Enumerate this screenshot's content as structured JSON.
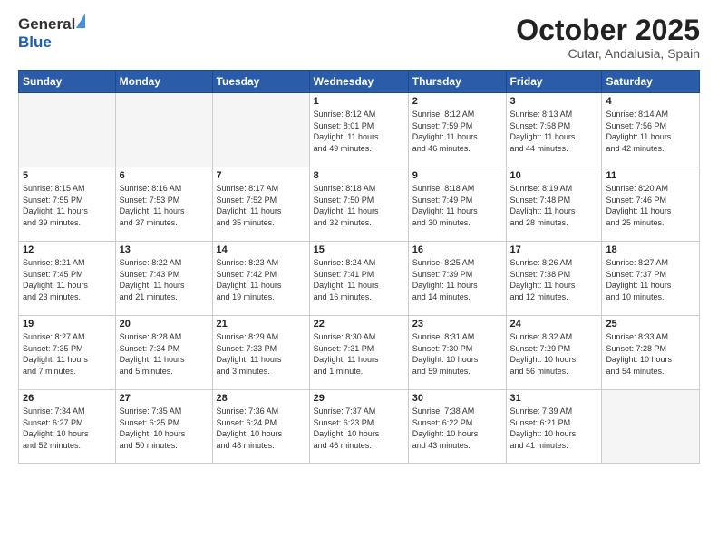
{
  "header": {
    "logo_general": "General",
    "logo_blue": "Blue",
    "title": "October 2025",
    "subtitle": "Cutar, Andalusia, Spain"
  },
  "days_of_week": [
    "Sunday",
    "Monday",
    "Tuesday",
    "Wednesday",
    "Thursday",
    "Friday",
    "Saturday"
  ],
  "weeks": [
    [
      {
        "day": "",
        "info": ""
      },
      {
        "day": "",
        "info": ""
      },
      {
        "day": "",
        "info": ""
      },
      {
        "day": "1",
        "info": "Sunrise: 8:12 AM\nSunset: 8:01 PM\nDaylight: 11 hours\nand 49 minutes."
      },
      {
        "day": "2",
        "info": "Sunrise: 8:12 AM\nSunset: 7:59 PM\nDaylight: 11 hours\nand 46 minutes."
      },
      {
        "day": "3",
        "info": "Sunrise: 8:13 AM\nSunset: 7:58 PM\nDaylight: 11 hours\nand 44 minutes."
      },
      {
        "day": "4",
        "info": "Sunrise: 8:14 AM\nSunset: 7:56 PM\nDaylight: 11 hours\nand 42 minutes."
      }
    ],
    [
      {
        "day": "5",
        "info": "Sunrise: 8:15 AM\nSunset: 7:55 PM\nDaylight: 11 hours\nand 39 minutes."
      },
      {
        "day": "6",
        "info": "Sunrise: 8:16 AM\nSunset: 7:53 PM\nDaylight: 11 hours\nand 37 minutes."
      },
      {
        "day": "7",
        "info": "Sunrise: 8:17 AM\nSunset: 7:52 PM\nDaylight: 11 hours\nand 35 minutes."
      },
      {
        "day": "8",
        "info": "Sunrise: 8:18 AM\nSunset: 7:50 PM\nDaylight: 11 hours\nand 32 minutes."
      },
      {
        "day": "9",
        "info": "Sunrise: 8:18 AM\nSunset: 7:49 PM\nDaylight: 11 hours\nand 30 minutes."
      },
      {
        "day": "10",
        "info": "Sunrise: 8:19 AM\nSunset: 7:48 PM\nDaylight: 11 hours\nand 28 minutes."
      },
      {
        "day": "11",
        "info": "Sunrise: 8:20 AM\nSunset: 7:46 PM\nDaylight: 11 hours\nand 25 minutes."
      }
    ],
    [
      {
        "day": "12",
        "info": "Sunrise: 8:21 AM\nSunset: 7:45 PM\nDaylight: 11 hours\nand 23 minutes."
      },
      {
        "day": "13",
        "info": "Sunrise: 8:22 AM\nSunset: 7:43 PM\nDaylight: 11 hours\nand 21 minutes."
      },
      {
        "day": "14",
        "info": "Sunrise: 8:23 AM\nSunset: 7:42 PM\nDaylight: 11 hours\nand 19 minutes."
      },
      {
        "day": "15",
        "info": "Sunrise: 8:24 AM\nSunset: 7:41 PM\nDaylight: 11 hours\nand 16 minutes."
      },
      {
        "day": "16",
        "info": "Sunrise: 8:25 AM\nSunset: 7:39 PM\nDaylight: 11 hours\nand 14 minutes."
      },
      {
        "day": "17",
        "info": "Sunrise: 8:26 AM\nSunset: 7:38 PM\nDaylight: 11 hours\nand 12 minutes."
      },
      {
        "day": "18",
        "info": "Sunrise: 8:27 AM\nSunset: 7:37 PM\nDaylight: 11 hours\nand 10 minutes."
      }
    ],
    [
      {
        "day": "19",
        "info": "Sunrise: 8:27 AM\nSunset: 7:35 PM\nDaylight: 11 hours\nand 7 minutes."
      },
      {
        "day": "20",
        "info": "Sunrise: 8:28 AM\nSunset: 7:34 PM\nDaylight: 11 hours\nand 5 minutes."
      },
      {
        "day": "21",
        "info": "Sunrise: 8:29 AM\nSunset: 7:33 PM\nDaylight: 11 hours\nand 3 minutes."
      },
      {
        "day": "22",
        "info": "Sunrise: 8:30 AM\nSunset: 7:31 PM\nDaylight: 11 hours\nand 1 minute."
      },
      {
        "day": "23",
        "info": "Sunrise: 8:31 AM\nSunset: 7:30 PM\nDaylight: 10 hours\nand 59 minutes."
      },
      {
        "day": "24",
        "info": "Sunrise: 8:32 AM\nSunset: 7:29 PM\nDaylight: 10 hours\nand 56 minutes."
      },
      {
        "day": "25",
        "info": "Sunrise: 8:33 AM\nSunset: 7:28 PM\nDaylight: 10 hours\nand 54 minutes."
      }
    ],
    [
      {
        "day": "26",
        "info": "Sunrise: 7:34 AM\nSunset: 6:27 PM\nDaylight: 10 hours\nand 52 minutes."
      },
      {
        "day": "27",
        "info": "Sunrise: 7:35 AM\nSunset: 6:25 PM\nDaylight: 10 hours\nand 50 minutes."
      },
      {
        "day": "28",
        "info": "Sunrise: 7:36 AM\nSunset: 6:24 PM\nDaylight: 10 hours\nand 48 minutes."
      },
      {
        "day": "29",
        "info": "Sunrise: 7:37 AM\nSunset: 6:23 PM\nDaylight: 10 hours\nand 46 minutes."
      },
      {
        "day": "30",
        "info": "Sunrise: 7:38 AM\nSunset: 6:22 PM\nDaylight: 10 hours\nand 43 minutes."
      },
      {
        "day": "31",
        "info": "Sunrise: 7:39 AM\nSunset: 6:21 PM\nDaylight: 10 hours\nand 41 minutes."
      },
      {
        "day": "",
        "info": ""
      }
    ]
  ]
}
